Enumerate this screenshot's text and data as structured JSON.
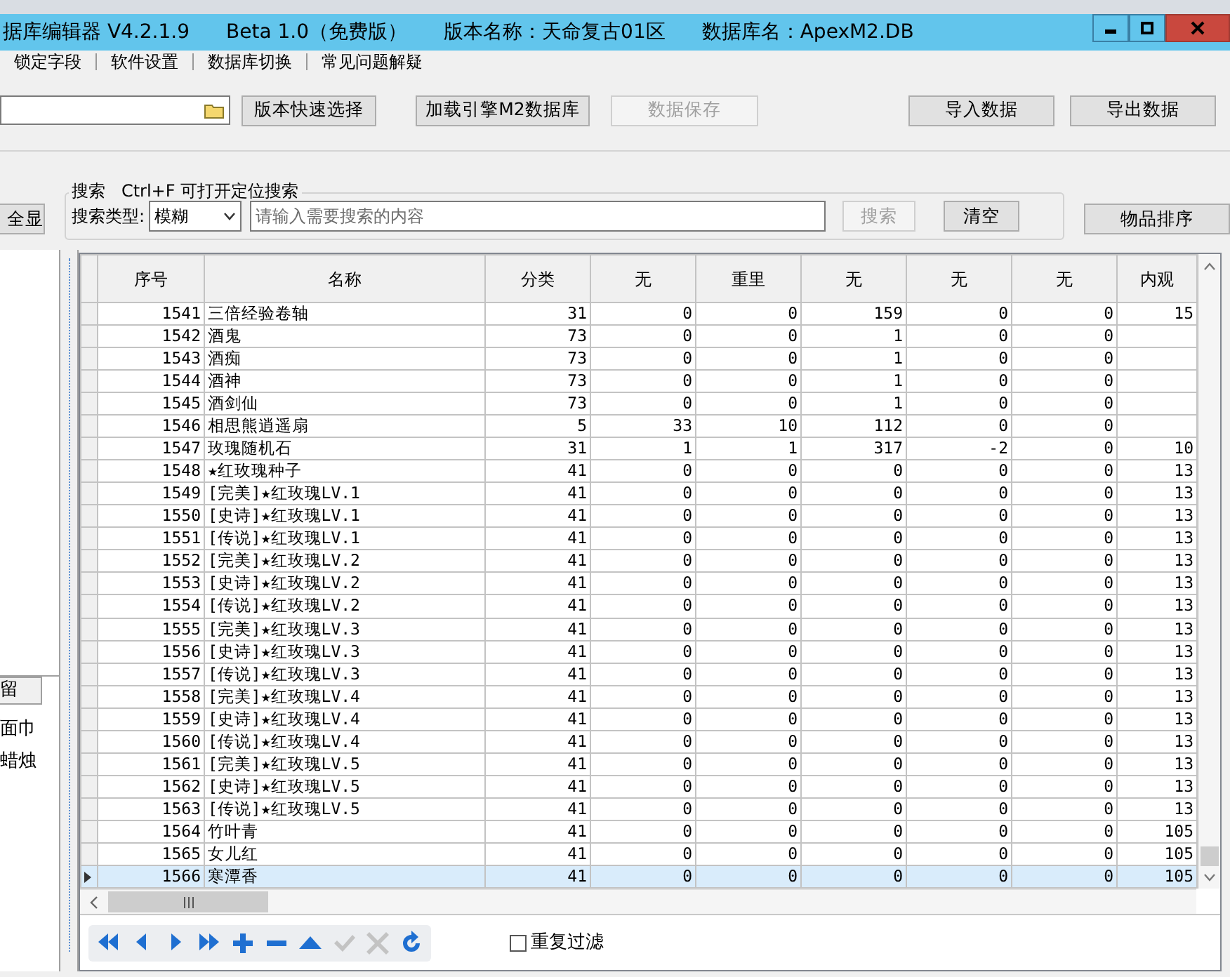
{
  "window": {
    "title_parts": [
      "据库编辑器 V4.2.1.9",
      "Beta 1.0（免费版）",
      "版本名称：天命复古01区",
      "数据库名：ApexM2.DB"
    ]
  },
  "menu": [
    "锁定字段",
    "软件设置",
    "数据库切换",
    "常见问题解疑"
  ],
  "toolbar": {
    "buttons": [
      {
        "label": "版本快速选择",
        "disabled": false
      },
      {
        "label": "加载引擎M2数据库",
        "disabled": false
      },
      {
        "label": "数据保存",
        "disabled": true
      },
      {
        "label": "导入数据",
        "disabled": false
      },
      {
        "label": "导出数据",
        "disabled": false
      }
    ]
  },
  "search": {
    "show_all": "全显",
    "group_title": "搜索   Ctrl+F 可打开定位搜索",
    "type_label": "搜索类型:",
    "type_value": "模糊",
    "placeholder": "请输入需要搜索的内容",
    "buttons": [
      {
        "label": "搜索",
        "disabled": true
      },
      {
        "label": "清空",
        "disabled": false
      }
    ],
    "sort_button": "物品排序"
  },
  "left_panel": {
    "tab": "留",
    "items": [
      "面巾",
      "蜡烛"
    ]
  },
  "table": {
    "columns": [
      "序号",
      "名称",
      "分类",
      "无",
      "重里",
      "无",
      "无",
      "无",
      "内观"
    ],
    "rows": [
      {
        "cells": [
          "1541",
          "三倍经验卷轴",
          "31",
          "0",
          "0",
          "159",
          "0",
          "0",
          "15"
        ],
        "selected": false
      },
      {
        "cells": [
          "1542",
          "酒鬼",
          "73",
          "0",
          "0",
          "1",
          "0",
          "0"
        ],
        "selected": false
      },
      {
        "cells": [
          "1543",
          "酒痴",
          "73",
          "0",
          "0",
          "1",
          "0",
          "0"
        ],
        "selected": false
      },
      {
        "cells": [
          "1544",
          "酒神",
          "73",
          "0",
          "0",
          "1",
          "0",
          "0"
        ],
        "selected": false
      },
      {
        "cells": [
          "1545",
          "酒剑仙",
          "73",
          "0",
          "0",
          "1",
          "0",
          "0"
        ],
        "selected": false
      },
      {
        "cells": [
          "1546",
          "相思熊逍遥扇",
          "5",
          "33",
          "10",
          "112",
          "0",
          "0"
        ],
        "selected": false
      },
      {
        "cells": [
          "1547",
          "玫瑰随机石",
          "31",
          "1",
          "1",
          "317",
          "-2",
          "0",
          "10"
        ],
        "selected": false
      },
      {
        "cells": [
          "1548",
          "★红玫瑰种子",
          "41",
          "0",
          "0",
          "0",
          "0",
          "0",
          "13"
        ],
        "selected": false
      },
      {
        "cells": [
          "1549",
          "[完美]★红玫瑰LV.1",
          "41",
          "0",
          "0",
          "0",
          "0",
          "0",
          "13"
        ],
        "selected": false
      },
      {
        "cells": [
          "1550",
          "[史诗]★红玫瑰LV.1",
          "41",
          "0",
          "0",
          "0",
          "0",
          "0",
          "13"
        ],
        "selected": false
      },
      {
        "cells": [
          "1551",
          "[传说]★红玫瑰LV.1",
          "41",
          "0",
          "0",
          "0",
          "0",
          "0",
          "13"
        ],
        "selected": false
      },
      {
        "cells": [
          "1552",
          "[完美]★红玫瑰LV.2",
          "41",
          "0",
          "0",
          "0",
          "0",
          "0",
          "13"
        ],
        "selected": false
      },
      {
        "cells": [
          "1553",
          "[史诗]★红玫瑰LV.2",
          "41",
          "0",
          "0",
          "0",
          "0",
          "0",
          "13"
        ],
        "selected": false
      },
      {
        "cells": [
          "1554",
          "[传说]★红玫瑰LV.2",
          "41",
          "0",
          "0",
          "0",
          "0",
          "0",
          "13"
        ],
        "selected": false
      },
      {
        "cells": [
          "1555",
          "[完美]★红玫瑰LV.3",
          "41",
          "0",
          "0",
          "0",
          "0",
          "0",
          "13"
        ],
        "selected": false
      },
      {
        "cells": [
          "1556",
          "[史诗]★红玫瑰LV.3",
          "41",
          "0",
          "0",
          "0",
          "0",
          "0",
          "13"
        ],
        "selected": false
      },
      {
        "cells": [
          "1557",
          "[传说]★红玫瑰LV.3",
          "41",
          "0",
          "0",
          "0",
          "0",
          "0",
          "13"
        ],
        "selected": false
      },
      {
        "cells": [
          "1558",
          "[完美]★红玫瑰LV.4",
          "41",
          "0",
          "0",
          "0",
          "0",
          "0",
          "13"
        ],
        "selected": false
      },
      {
        "cells": [
          "1559",
          "[史诗]★红玫瑰LV.4",
          "41",
          "0",
          "0",
          "0",
          "0",
          "0",
          "13"
        ],
        "selected": false
      },
      {
        "cells": [
          "1560",
          "[传说]★红玫瑰LV.4",
          "41",
          "0",
          "0",
          "0",
          "0",
          "0",
          "13"
        ],
        "selected": false
      },
      {
        "cells": [
          "1561",
          "[完美]★红玫瑰LV.5",
          "41",
          "0",
          "0",
          "0",
          "0",
          "0",
          "13"
        ],
        "selected": false
      },
      {
        "cells": [
          "1562",
          "[史诗]★红玫瑰LV.5",
          "41",
          "0",
          "0",
          "0",
          "0",
          "0",
          "13"
        ],
        "selected": false
      },
      {
        "cells": [
          "1563",
          "[传说]★红玫瑰LV.5",
          "41",
          "0",
          "0",
          "0",
          "0",
          "0",
          "13"
        ],
        "selected": false
      },
      {
        "cells": [
          "1564",
          "竹叶青",
          "41",
          "0",
          "0",
          "0",
          "0",
          "0",
          "105"
        ],
        "selected": false
      },
      {
        "cells": [
          "1565",
          "女儿红",
          "41",
          "0",
          "0",
          "0",
          "0",
          "0",
          "105"
        ],
        "selected": false
      },
      {
        "cells": [
          "1566",
          "寒潭香",
          "41",
          "0",
          "0",
          "0",
          "0",
          "0",
          "105"
        ],
        "selected": true
      }
    ]
  },
  "navigator": [
    {
      "kind": "first",
      "disabled": false
    },
    {
      "kind": "prior",
      "disabled": false
    },
    {
      "kind": "next",
      "disabled": false
    },
    {
      "kind": "last",
      "disabled": false
    },
    {
      "kind": "insert",
      "disabled": false
    },
    {
      "kind": "delete",
      "disabled": false
    },
    {
      "kind": "edit",
      "disabled": false
    },
    {
      "kind": "post",
      "disabled": true
    },
    {
      "kind": "cancel",
      "disabled": true
    },
    {
      "kind": "refresh",
      "disabled": false
    }
  ],
  "repeat_filter": {
    "label": "重复过滤",
    "checked": false
  }
}
